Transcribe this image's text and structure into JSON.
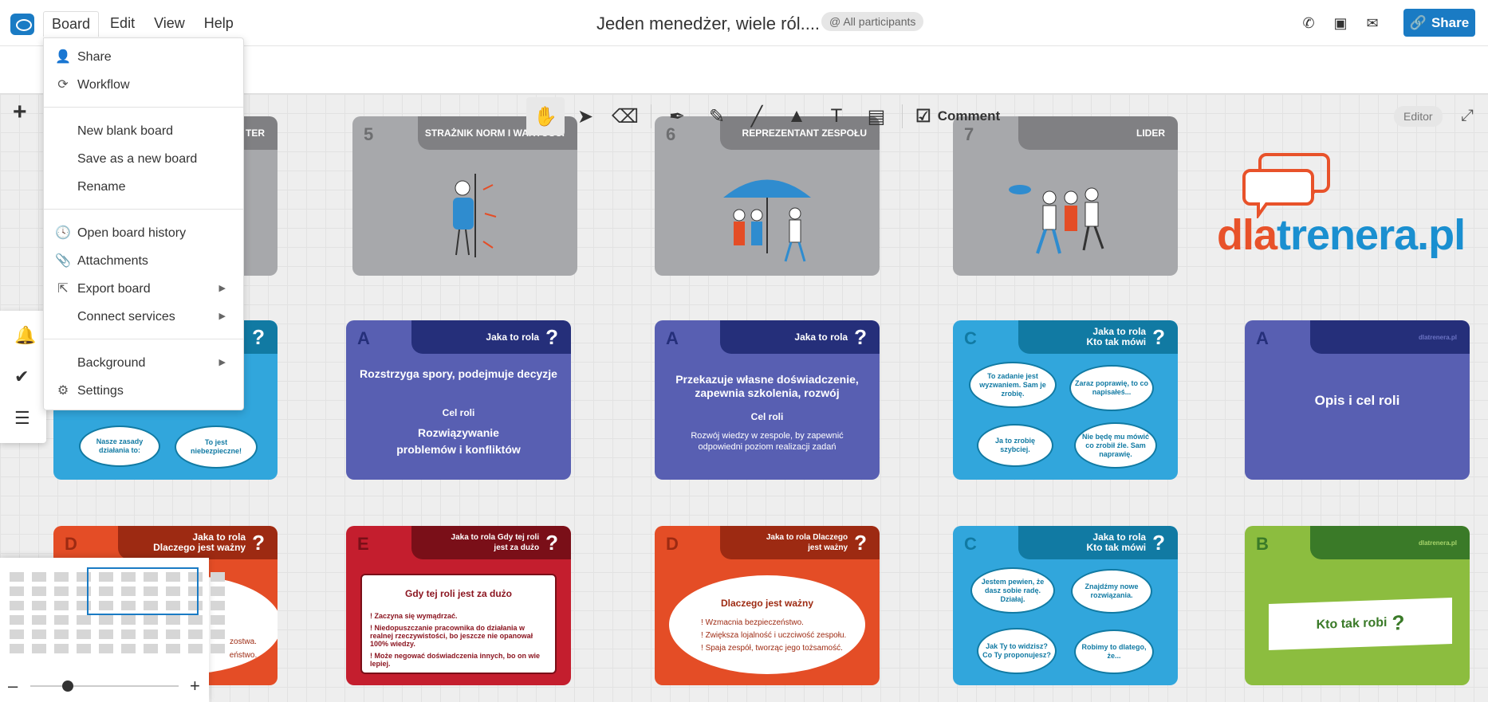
{
  "app": {
    "colors": {
      "accent": "#1a7bc4"
    }
  },
  "menubar": {
    "items": [
      "Board",
      "Edit",
      "View",
      "Help"
    ]
  },
  "board": {
    "title": "Jeden menedżer, wiele ról....",
    "participants": "@ All participants"
  },
  "header": {
    "share_label": "Share"
  },
  "toolbar": {
    "comment_label": "Comment",
    "editor_badge": "Editor"
  },
  "board_menu": {
    "share": "Share",
    "workflow": "Workflow",
    "new_blank": "New blank board",
    "save_as_new": "Save as a new board",
    "rename": "Rename",
    "history": "Open board history",
    "attachments": "Attachments",
    "export": "Export board",
    "connect": "Connect services",
    "background": "Background",
    "settings": "Settings"
  },
  "cards": {
    "row1": [
      {
        "num": "",
        "title": "TER"
      },
      {
        "num": "5",
        "title": "STRAŻNIK NORM I WARTOŚCI"
      },
      {
        "num": "6",
        "title": "REPREZENTANT ZESPOŁU"
      },
      {
        "num": "7",
        "title": "LIDER"
      }
    ],
    "row2": {
      "c0": {
        "bubble1": "Nasze zasady działania to:",
        "bubble2": "To jest niebezpieczne!"
      },
      "c1": {
        "letter": "A",
        "tab": "Jaka to rola",
        "main": "Rozstrzyga spory, podejmuje decyzje",
        "sub": "Cel roli",
        "goal": "Rozwiązywanie problemów i konfliktów"
      },
      "c2": {
        "letter": "A",
        "tab": "Jaka to rola",
        "main": "Przekazuje własne doświadczenie, zapewnia szkolenia, rozwój",
        "sub": "Cel roli",
        "goal": "Rozwój wiedzy w zespole, by zapewnić odpowiedni poziom realizacji zadań"
      },
      "c3": {
        "letter": "C",
        "tab": "Jaka to rola Kto tak mówi",
        "b1": "To zadanie jest wyzwaniem. Sam je zrobię.",
        "b2": "Zaraz poprawię, to co napisałeś...",
        "b3": "Ja to zrobię szybciej.",
        "b4": "Nie będę mu mówić co zrobił źle. Sam naprawię."
      },
      "c4": {
        "letter": "A",
        "tab": "dlatrenera.pl",
        "main": "Opis i cel roli"
      }
    },
    "row3": {
      "c0": {
        "letter": "D",
        "tab": "Jaka to rola Dlaczego jest ważny",
        "l1": "zostwa.",
        "l2": "eństwo."
      },
      "c1": {
        "letter": "E",
        "tab": "Jaka to rola Gdy tej roli jest za dużo",
        "title": "Gdy tej roli jest za dużo",
        "i1": "Zaczyna się wymądrzać.",
        "i2": "Niedopuszczanie pracownika do działania w realnej rzeczywistości, bo jeszcze nie opanował 100% wiedzy.",
        "i3": "Może negować doświadczenia innych, bo on wie lepiej."
      },
      "c2": {
        "letter": "D",
        "tab": "Jaka to rola Dlaczego jest ważny",
        "title": "Dlaczego jest ważny",
        "i1": "Wzmacnia bezpieczeństwo.",
        "i2": "Zwiększa lojalność i uczciwość zespołu.",
        "i3": "Spaja zespół, tworząc jego tożsamość."
      },
      "c3": {
        "letter": "C",
        "tab": "Jaka to rola Kto tak mówi",
        "b1": "Jestem pewien, że dasz sobie radę. Działaj.",
        "b2": "Znajdźmy nowe rozwiązania.",
        "b3": "Jak Ty to widzisz? Co Ty proponujesz?",
        "b4": "Robimy to dlatego, że..."
      },
      "c4": {
        "letter": "B",
        "tab": "dlatrenera.pl",
        "main": "Kto tak robi"
      }
    }
  },
  "brand": {
    "part1": "dla",
    "part2": "trenera.pl"
  }
}
